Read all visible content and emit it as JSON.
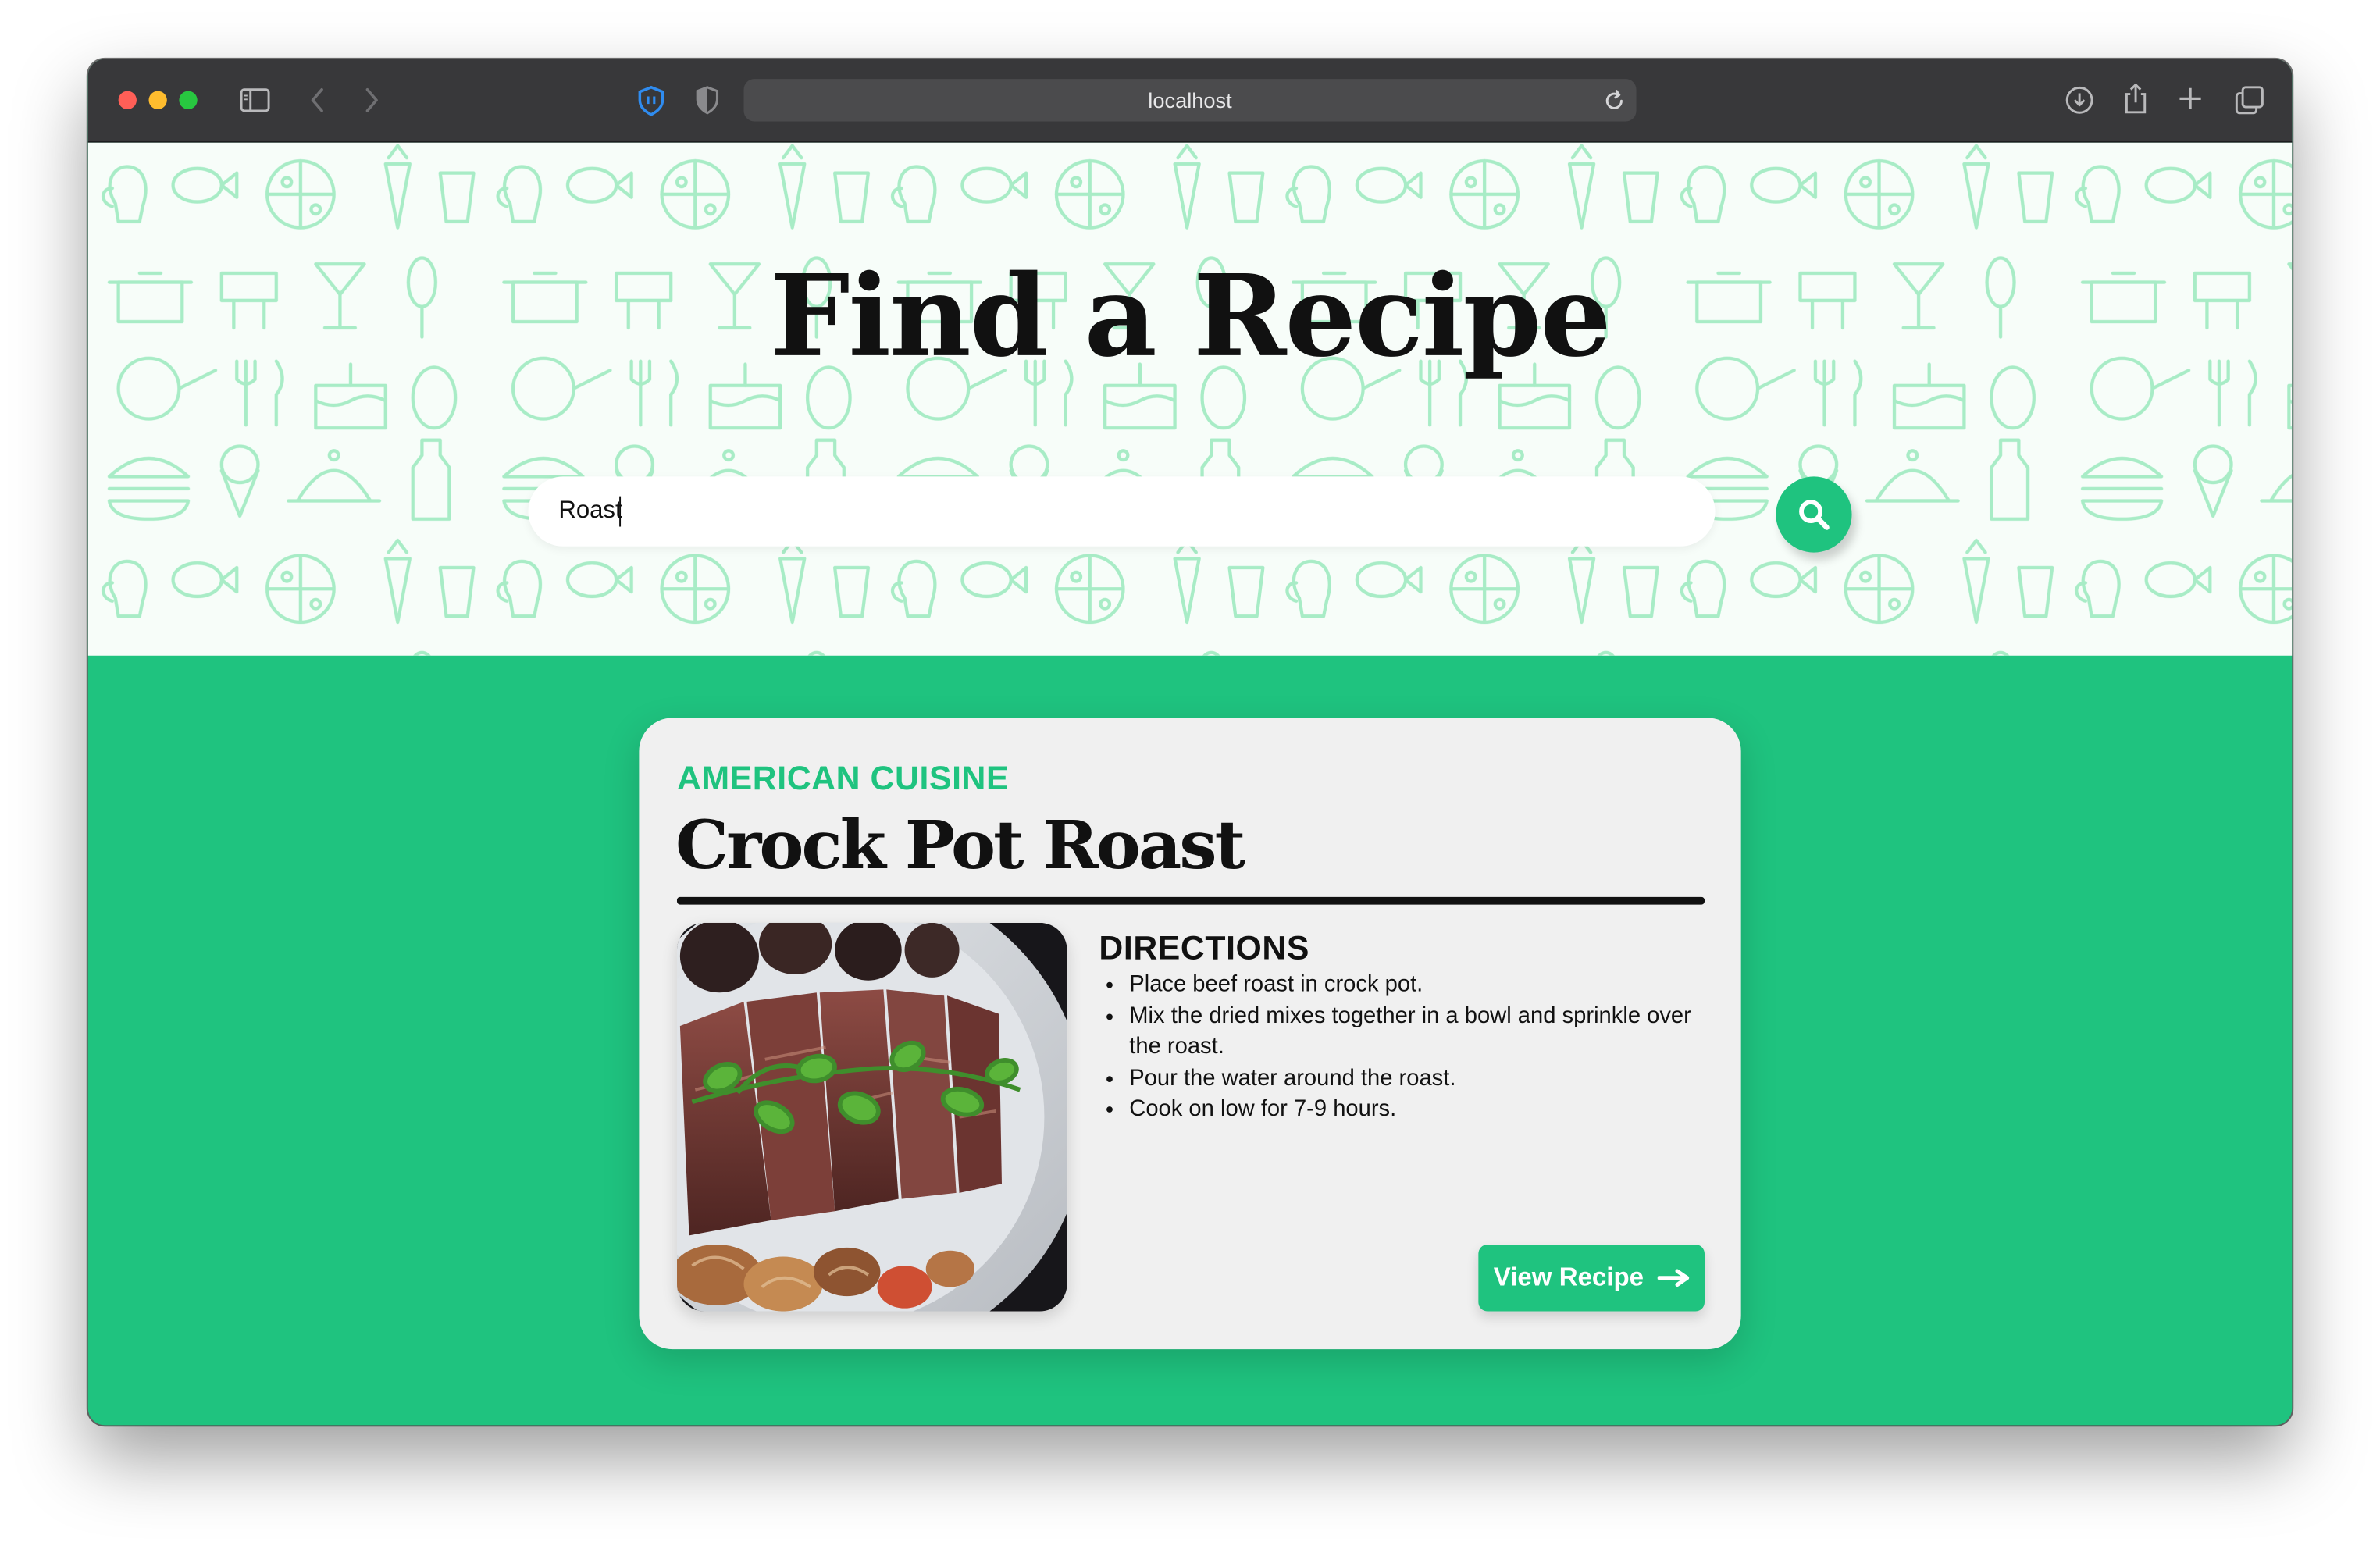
{
  "browser": {
    "address": "localhost",
    "traffic_light_colors": [
      "#ff5f57",
      "#febc2e",
      "#28c840"
    ],
    "toolbar_icons": [
      "sidebar-icon",
      "back-icon",
      "forward-icon",
      "shield-icon",
      "privacy-icon",
      "reload-icon",
      "download-icon",
      "share-icon",
      "new-tab-icon",
      "tabs-overview-icon"
    ]
  },
  "hero": {
    "title": "Find a Recipe",
    "search_value": "Roast",
    "search_icon": "search-icon"
  },
  "recipe": {
    "cuisine": "AMERICAN CUISINE",
    "title": "Crock Pot Roast",
    "directions_heading": "DIRECTIONS",
    "directions": [
      "Place beef roast in crock pot.",
      "Mix the dried mixes together in a bowl and sprinkle over the roast.",
      "Pour the water around the roast.",
      "Cook on low for 7-9 hours."
    ],
    "view_button": "View Recipe",
    "view_button_icon": "arrow-right-icon"
  },
  "colors": {
    "accent": "#1fc37f",
    "toolbar": "#38383a",
    "card": "#f0f0f0",
    "hero_bg": "#f7fdf9",
    "doodle": "#a8ecc6"
  }
}
